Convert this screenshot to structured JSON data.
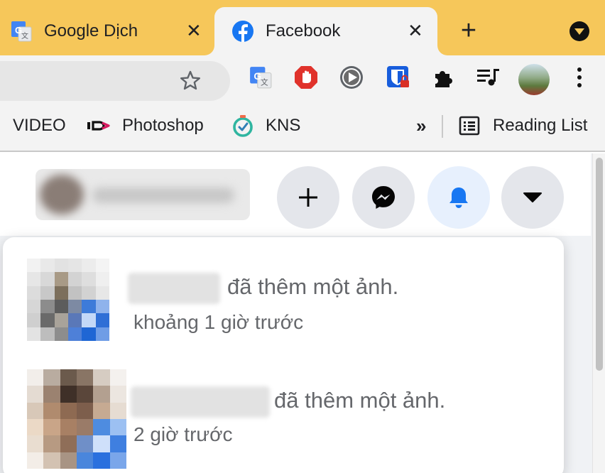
{
  "tabs": [
    {
      "title": "Google Dịch",
      "icon": "google-translate-icon",
      "active": false
    },
    {
      "title": "Facebook",
      "icon": "facebook-icon",
      "active": true
    }
  ],
  "tab_close_glyph": "✕",
  "new_tab_glyph": "+",
  "toolbar": {
    "bookmark_star_icon": "star-outline-icon",
    "extensions": [
      "google-translate-icon",
      "adblock-icon",
      "play-icon",
      "bitwarden-lock-icon",
      "puzzle-icon",
      "media-queue-icon",
      "profile-avatar-icon",
      "more-vert-icon"
    ]
  },
  "bookmarks": {
    "items": [
      {
        "label": "VIDEO",
        "icon": null
      },
      {
        "label": "Photoshop",
        "icon": "id-logo-icon"
      },
      {
        "label": "KNS",
        "icon": "timer-icon"
      }
    ],
    "overflow_glyph": "»",
    "reading_list": "Reading List"
  },
  "facebook": {
    "header_buttons": [
      "create-icon",
      "messenger-icon",
      "bell-icon",
      "caret-down-icon"
    ],
    "notifications": [
      {
        "action": "đã thêm một ảnh.",
        "time": "khoảng 1 giờ trước"
      },
      {
        "action": "đã thêm một ảnh.",
        "time": "2 giờ trước"
      }
    ]
  },
  "colors": {
    "tabstrip": "#f6c75a",
    "toolbar": "#f3f3f3",
    "fb_blue": "#1877f2",
    "secondary_text": "#65676b"
  }
}
